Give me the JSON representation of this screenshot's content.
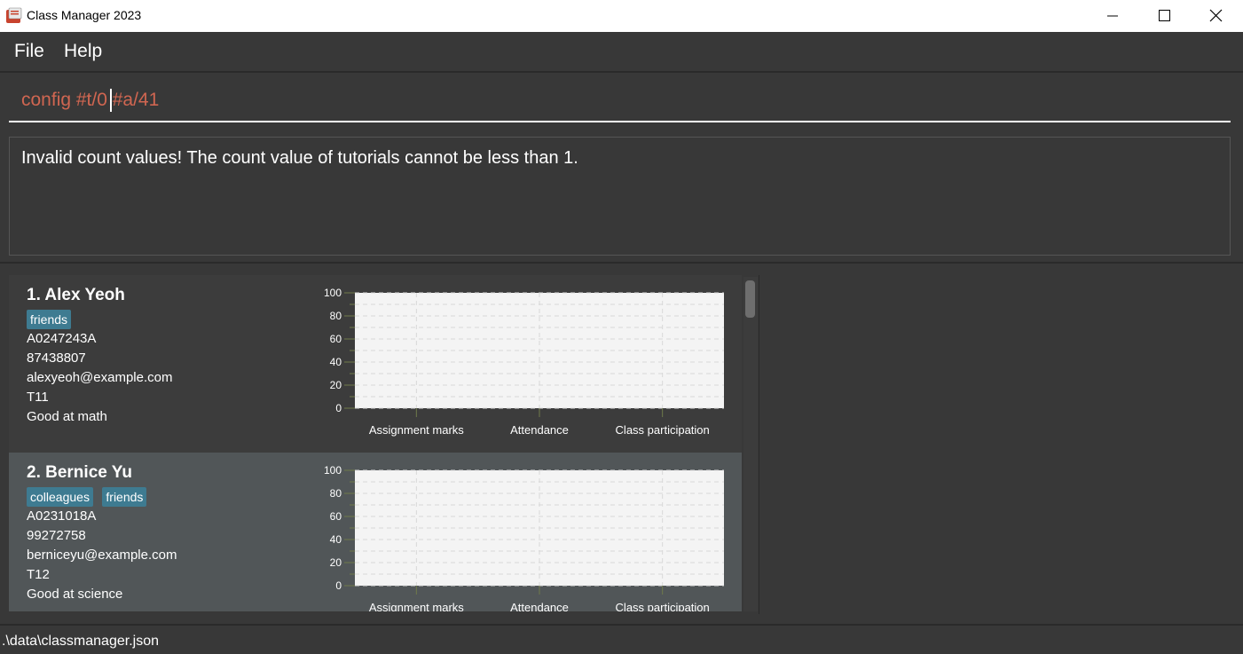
{
  "window": {
    "title": "Class Manager 2023",
    "icon": "app-icon",
    "controls": [
      "minimize-icon",
      "maximize-icon",
      "close-icon"
    ]
  },
  "menu": {
    "file": "File",
    "help": "Help"
  },
  "command": {
    "value": "config #t/0 #a/41"
  },
  "result": {
    "message": "Invalid count values! The count value of tutorials cannot be less than 1."
  },
  "persons": [
    {
      "name": "1.  Alex Yeoh",
      "tags": [
        "friends"
      ],
      "student_number": "A0247243A",
      "phone": "87438807",
      "email": "alexyeoh@example.com",
      "class_number": "T11",
      "comment": "Good at math"
    },
    {
      "name": "2.  Bernice Yu",
      "tags": [
        "colleagues",
        "friends"
      ],
      "student_number": "A0231018A",
      "phone": "99272758",
      "email": "berniceyu@example.com",
      "class_number": "T12",
      "comment": "Good at science"
    }
  ],
  "chart_data": [
    {
      "type": "bar",
      "categories": [
        "Assignment marks",
        "Attendance",
        "Class participation"
      ],
      "values": [
        0,
        0,
        0
      ],
      "ylim": [
        0,
        100
      ],
      "yticks": [
        0,
        20,
        40,
        60,
        80,
        100
      ],
      "grid": true
    },
    {
      "type": "bar",
      "categories": [
        "Assignment marks",
        "Attendance",
        "Class participation"
      ],
      "values": [
        0,
        0,
        0
      ],
      "ylim": [
        0,
        100
      ],
      "yticks": [
        0,
        20,
        40,
        60,
        80,
        100
      ],
      "grid": true
    }
  ],
  "status": {
    "path": ".\\data\\classmanager.json"
  }
}
